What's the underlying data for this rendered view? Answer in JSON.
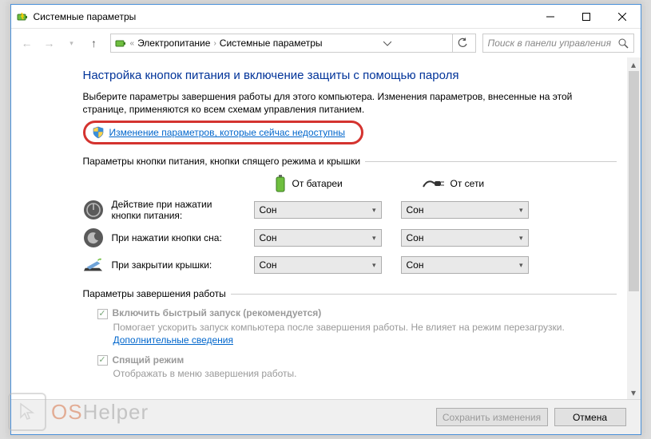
{
  "window": {
    "title": "Системные параметры"
  },
  "nav": {
    "crumb1": "Электропитание",
    "crumb2": "Системные параметры",
    "search_placeholder": "Поиск в панели управления"
  },
  "page": {
    "heading": "Настройка кнопок питания и включение защиты с помощью пароля",
    "intro": "Выберите параметры завершения работы для этого компьютера. Изменения параметров, внесенные на этой странице, применяются ко всем схемам управления питанием.",
    "change_link": "Изменение параметров, которые сейчас недоступны",
    "group1_title": "Параметры кнопки питания, кнопки спящего режима и крышки",
    "col_battery": "От батареи",
    "col_ac": "От сети",
    "row_power": "Действие при нажатии кнопки питания:",
    "row_sleep": "При нажатии кнопки сна:",
    "row_lid": "При закрытии крышки:",
    "combo_value": "Сон",
    "group2_title": "Параметры завершения работы",
    "fast_title": "Включить быстрый запуск (рекомендуется)",
    "fast_desc": "Помогает ускорить запуск компьютера после завершения работы. Не влияет на режим перезагрузки. ",
    "fast_link": "Дополнительные сведения",
    "sleep_title": "Спящий режим",
    "sleep_desc": "Отображать в меню завершения работы."
  },
  "footer": {
    "save": "Сохранить изменения",
    "cancel": "Отмена"
  },
  "watermark": {
    "os": "OS",
    "helper": "Helper"
  }
}
